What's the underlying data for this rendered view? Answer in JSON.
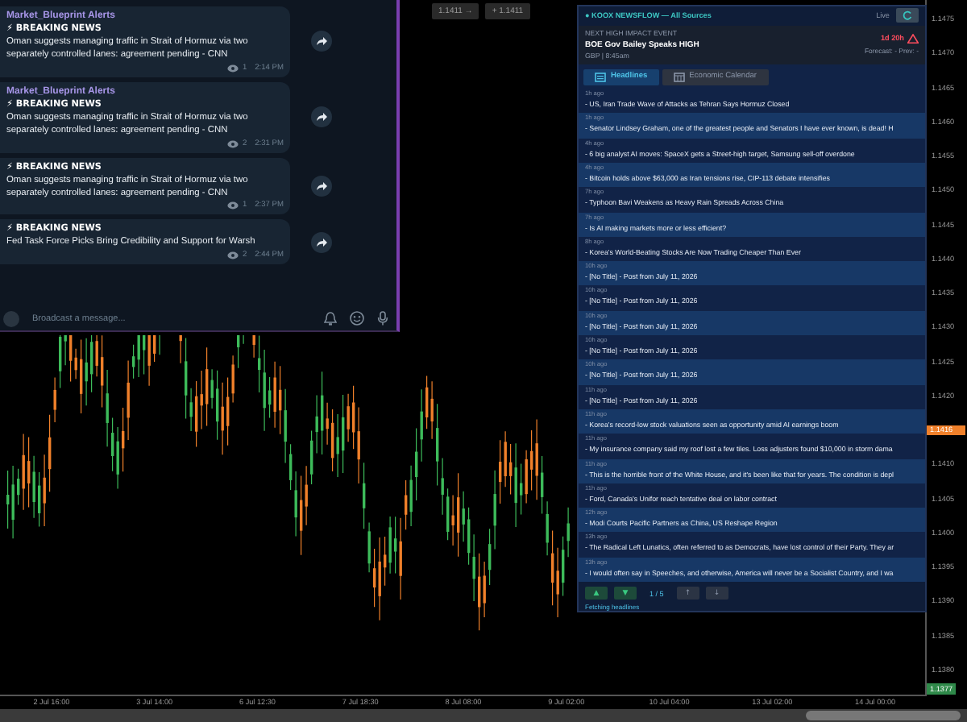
{
  "price_boxes": [
    "1.1411 →",
    "+ 1.1411"
  ],
  "chat": {
    "messages": [
      {
        "sender": "Market_Blueprint Alerts",
        "headline": "⚡ BREAKING NEWS",
        "text": "Oman suggests managing traffic in Strait of Hormuz via two separately controlled lanes: agreement pending - CNN",
        "views": "1",
        "time": "2:14 PM"
      },
      {
        "sender": "Market_Blueprint Alerts",
        "headline": "⚡ BREAKING NEWS",
        "text": "Oman suggests managing traffic in Strait of Hormuz via two separately controlled lanes: agreement pending - CNN",
        "views": "2",
        "time": "2:31 PM"
      },
      {
        "headline": "⚡ BREAKING NEWS",
        "text": "Oman suggests managing traffic in Strait of Hormuz via two separately controlled lanes: agreement pending - CNN",
        "views": "1",
        "time": "2:37 PM"
      },
      {
        "headline": "⚡ BREAKING NEWS",
        "text": "Fed Task Force Picks Bring Credibility and Support for Warsh",
        "views": "2",
        "time": "2:44 PM"
      }
    ],
    "input": {
      "placeholder": "Broadcast a message..."
    }
  },
  "news_panel": {
    "title": "● KOOX NEWSFLOW — All Sources",
    "live": "Live",
    "event": {
      "label": "NEXT HIGH IMPACT EVENT",
      "title": "BOE Gov Bailey Speaks HIGH",
      "meta": "GBP | 8:45am",
      "countdown": "1d 20h",
      "forecast": "Forecast: - Prev: -"
    },
    "tabs": [
      {
        "label": "Headlines",
        "selected": true
      },
      {
        "label": "Economic Calendar",
        "selected": false
      }
    ],
    "headlines": [
      {
        "age": "1h ago",
        "text": "- US, Iran Trade Wave of Attacks as Tehran Says Hormuz Closed"
      },
      {
        "age": "1h ago",
        "text": "- Senator Lindsey Graham, one of the greatest people and Senators I have ever known, is dead! H"
      },
      {
        "age": "4h ago",
        "text": "- 6 big analyst AI moves: SpaceX gets a Street-high target, Samsung sell-off overdone"
      },
      {
        "age": "4h ago",
        "text": "- Bitcoin holds above $63,000 as Iran tensions rise, CIP-113 debate intensifies"
      },
      {
        "age": "7h ago",
        "text": "- Typhoon Bavi Weakens as Heavy Rain Spreads Across China"
      },
      {
        "age": "7h ago",
        "text": "- Is AI making markets more or less efficient?"
      },
      {
        "age": "8h ago",
        "text": "- Korea's World-Beating Stocks Are Now Trading Cheaper Than Ever"
      },
      {
        "age": "10h ago",
        "text": "- [No Title] - Post from July 11, 2026"
      },
      {
        "age": "10h ago",
        "text": "- [No Title] - Post from July 11, 2026"
      },
      {
        "age": "10h ago",
        "text": "- [No Title] - Post from July 11, 2026"
      },
      {
        "age": "10h ago",
        "text": "- [No Title] - Post from July 11, 2026"
      },
      {
        "age": "10h ago",
        "text": "- [No Title] - Post from July 11, 2026"
      },
      {
        "age": "11h ago",
        "text": "- [No Title] - Post from July 11, 2026"
      },
      {
        "age": "11h ago",
        "text": "- Korea's record-low stock valuations seen as opportunity amid AI earnings boom"
      },
      {
        "age": "11h ago",
        "text": "- My insurance company said my roof lost a few tiles. Loss adjusters found $10,000 in storm dama"
      },
      {
        "age": "11h ago",
        "text": "- This is the horrible front of the White House, and it's been like that for years. The condition is depl"
      },
      {
        "age": "11h ago",
        "text": "- Ford, Canada's Unifor reach tentative deal on labor contract"
      },
      {
        "age": "12h ago",
        "text": "- Modi Courts Pacific Partners as China, US Reshape Region"
      },
      {
        "age": "13h ago",
        "text": "- The Radical Left Lunatics, often referred to as Democrats, have lost control of their Party. They ar"
      },
      {
        "age": "13h ago",
        "text": "- I would often say in Speeches, and otherwise, America will never be a Socialist Country, and I wa"
      }
    ],
    "pager": {
      "up": "▲",
      "down": "▼",
      "page": "1 / 5",
      "prev": "↑",
      "next": "↓"
    },
    "status": "Fetching headlines"
  },
  "price_axis": {
    "labels": [
      {
        "text": "1.1475",
        "kind": "tick"
      },
      {
        "text": "1.1470",
        "kind": "tick"
      },
      {
        "text": "1.1465",
        "kind": "tick"
      },
      {
        "text": "1.1460",
        "kind": "tick"
      },
      {
        "text": "1.1455",
        "kind": "tick"
      },
      {
        "text": "1.1450",
        "kind": "tick"
      },
      {
        "text": "1.1445",
        "kind": "tick"
      },
      {
        "text": "1.1440",
        "kind": "tick"
      },
      {
        "text": "1.1435",
        "kind": "tick"
      },
      {
        "text": "1.1430",
        "kind": "tick"
      },
      {
        "text": "1.1425",
        "kind": "tick"
      },
      {
        "text": "1.1420",
        "kind": "tick"
      },
      {
        "text": "1.1416",
        "kind": "current"
      },
      {
        "text": "1.1410",
        "kind": "tick"
      },
      {
        "text": "1.1405",
        "kind": "tick"
      },
      {
        "text": "1.1400",
        "kind": "tick"
      },
      {
        "text": "1.1395",
        "kind": "tick"
      },
      {
        "text": "1.1390",
        "kind": "tick"
      },
      {
        "text": "1.1385",
        "kind": "tick"
      },
      {
        "text": "1.1380",
        "kind": "tick"
      }
    ],
    "bid": "1.1377"
  },
  "time_axis": [
    "2 Jul 16:00",
    "3 Jul 14:00",
    "6 Jul 12:30",
    "7 Jul 18:30",
    "8 Jul 08:00",
    "9 Jul 02:00",
    "10 Jul 04:00",
    "13 Jul 02:00",
    "14 Jul 00:00"
  ]
}
